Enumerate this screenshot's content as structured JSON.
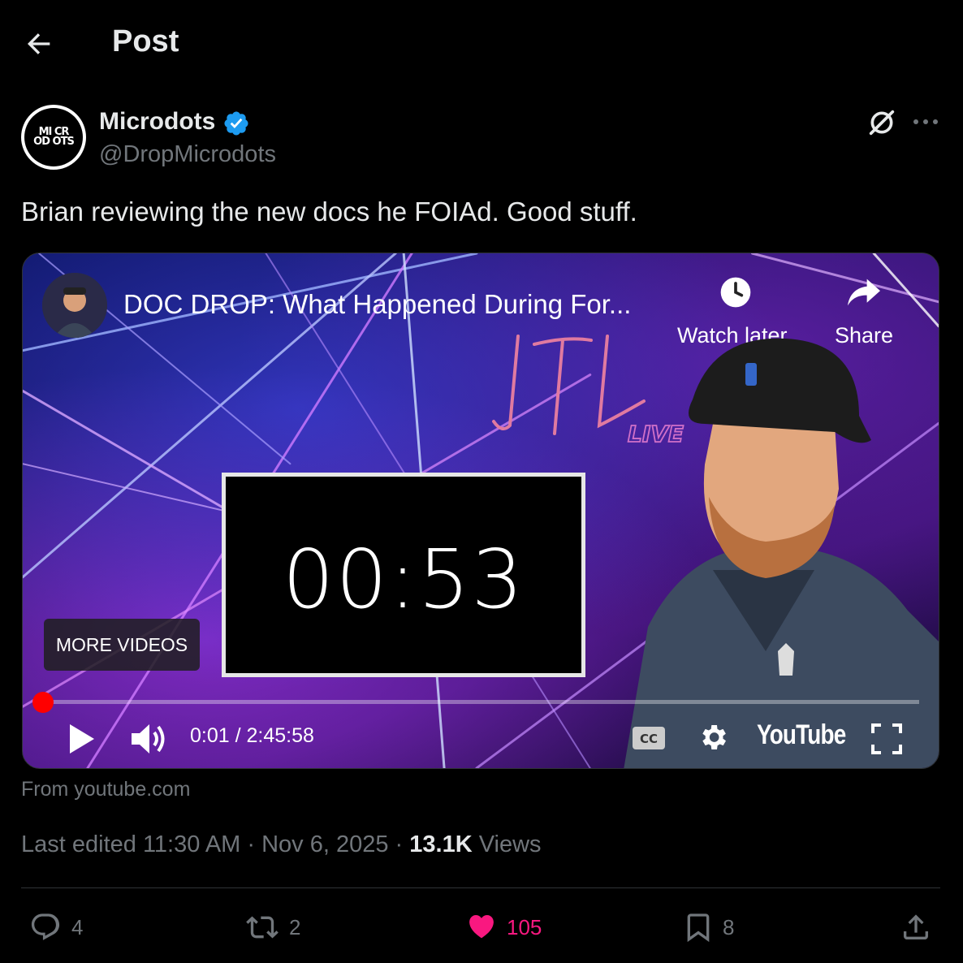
{
  "header": {
    "title": "Post"
  },
  "author": {
    "name": "Microdots",
    "handle": "@DropMicrodots",
    "avatar_text": "MI CR OD OTS"
  },
  "tweet": {
    "text": "Brian reviewing the new docs he FOIAd. Good stuff."
  },
  "video": {
    "title": "DOC DROP: What Happened During For...",
    "watch_later_label": "Watch later",
    "share_label": "Share",
    "overlay_text": "LTL",
    "overlay_sub": "LIVE",
    "timer": "00:53",
    "more_videos_label": "MORE VIDEOS",
    "time_display": "0:01 / 2:45:58",
    "progress_fraction": 0.0001,
    "cc_label": "CC",
    "brand": "YouTube",
    "source": "From youtube.com"
  },
  "meta": {
    "edited": "Last edited 11:30 AM · Nov 6, 2025 · ",
    "views_count": "13.1K",
    "views_label": " Views"
  },
  "actions": {
    "replies": "4",
    "reposts": "2",
    "likes": "105",
    "bookmarks": "8"
  },
  "colors": {
    "background": "#000000",
    "text_primary": "#e7e9ea",
    "text_secondary": "#71767b",
    "verified": "#1d9bf0",
    "like": "#f91880",
    "progress": "#ff0000"
  }
}
